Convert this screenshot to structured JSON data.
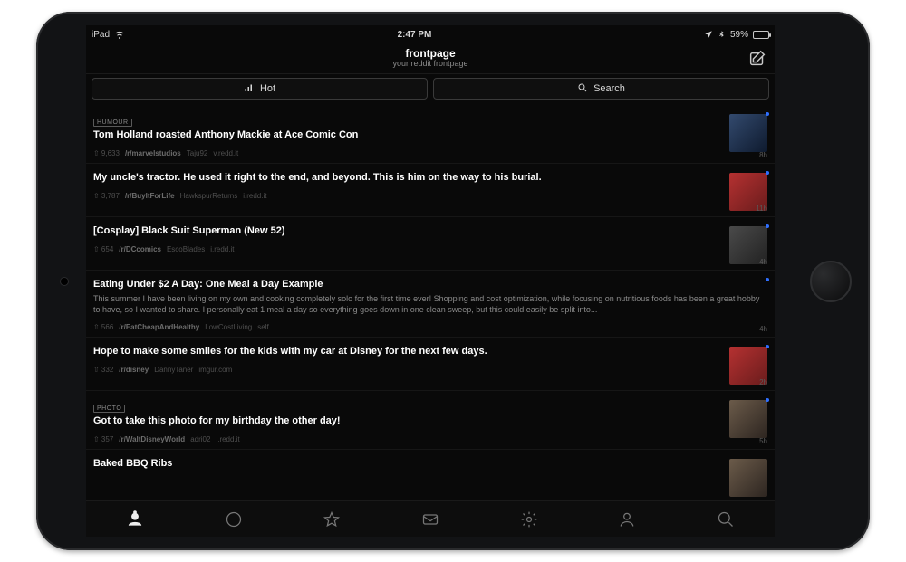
{
  "statusbar": {
    "device": "iPad",
    "time": "2:47 PM",
    "battery_pct": "59%"
  },
  "header": {
    "title": "frontpage",
    "subtitle": "your reddit frontpage"
  },
  "filters": {
    "hot_label": "Hot",
    "search_label": "Search"
  },
  "posts": [
    {
      "title": "Tom Holland roasted Anthony Mackie at Ace Comic Con",
      "flair": "HUMOUR",
      "score": "9,633",
      "subreddit": "/r/marvelstudios",
      "author": "Taju92",
      "domain": "v.redd.it",
      "age": "8h",
      "thumb": "blue",
      "unread": true
    },
    {
      "title": "My uncle's tractor. He used it right to the end, and beyond. This is him on the way to his burial.",
      "flair": "",
      "score": "3,787",
      "subreddit": "/r/BuyItForLife",
      "author": "HawkspurReturns",
      "domain": "i.redd.it",
      "age": "11h",
      "thumb": "red",
      "unread": true
    },
    {
      "title": "[Cosplay] Black Suit Superman (New 52)",
      "flair": "",
      "score": "654",
      "subreddit": "/r/DCcomics",
      "author": "EscoBlades",
      "domain": "i.redd.it",
      "age": "4h",
      "thumb": "gray",
      "unread": true
    },
    {
      "title": "Eating Under $2 A Day: One Meal a Day Example",
      "preview": "This summer I have been living on my own and cooking completely solo for the first time ever! Shopping and cost optimization, while focusing on nutritious foods has been a great hobby to have, so I wanted to share. I personally eat 1 meal a day so everything goes down in one clean sweep, but this could easily be split into...",
      "flair": "",
      "score": "566",
      "subreddit": "/r/EatCheapAndHealthy",
      "author": "LowCostLiving",
      "domain": "self",
      "age": "4h",
      "thumb": "",
      "unread": true
    },
    {
      "title": "Hope to make some smiles for the kids with my car at Disney for the next few days.",
      "flair": "",
      "score": "332",
      "subreddit": "/r/disney",
      "author": "DannyTaner",
      "domain": "imgur.com",
      "age": "2h",
      "thumb": "red",
      "unread": true
    },
    {
      "title": "Got to take this photo for my birthday the other day!",
      "flair": "PHOTO",
      "score": "357",
      "subreddit": "/r/WaltDisneyWorld",
      "author": "adri02",
      "domain": "i.redd.it",
      "age": "5h",
      "thumb": "photo",
      "unread": true
    },
    {
      "title": "Baked BBQ Ribs",
      "flair": "",
      "score": "",
      "subreddit": "",
      "author": "",
      "domain": "",
      "age": "",
      "thumb": "photo",
      "unread": false
    }
  ]
}
